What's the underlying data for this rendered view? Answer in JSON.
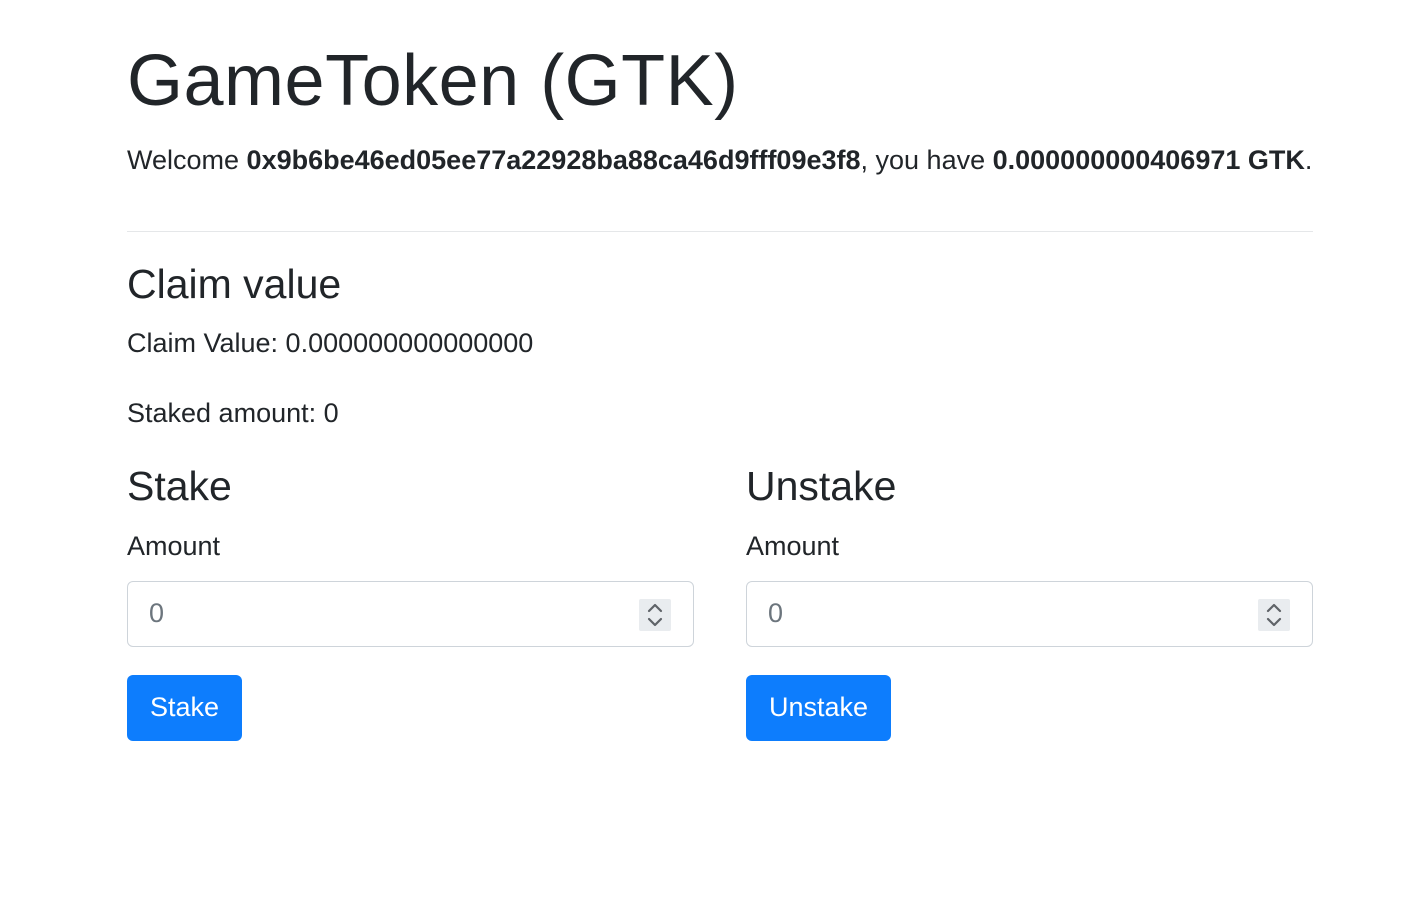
{
  "header": {
    "title": "GameToken (GTK)",
    "welcome_prefix": "Welcome ",
    "address": "0x9b6be46ed05ee77a22928ba88ca46d9fff09e3f8",
    "welcome_middle": ", you have ",
    "balance": "0.000000000406971 GTK",
    "welcome_suffix": "."
  },
  "claim": {
    "title": "Claim value",
    "claim_value_text": "Claim Value: 0.000000000000000",
    "staked_amount_text": "Staked amount: 0"
  },
  "stake": {
    "title": "Stake",
    "amount_label": "Amount",
    "amount_placeholder": "0",
    "button_label": "Stake"
  },
  "unstake": {
    "title": "Unstake",
    "amount_label": "Amount",
    "amount_placeholder": "0",
    "button_label": "Unstake"
  },
  "icons": {
    "spinner": "up-down-spinner-icon"
  },
  "colors": {
    "primary_button": "#0d7dfd",
    "text": "#212529",
    "input_border": "#ced4da"
  }
}
